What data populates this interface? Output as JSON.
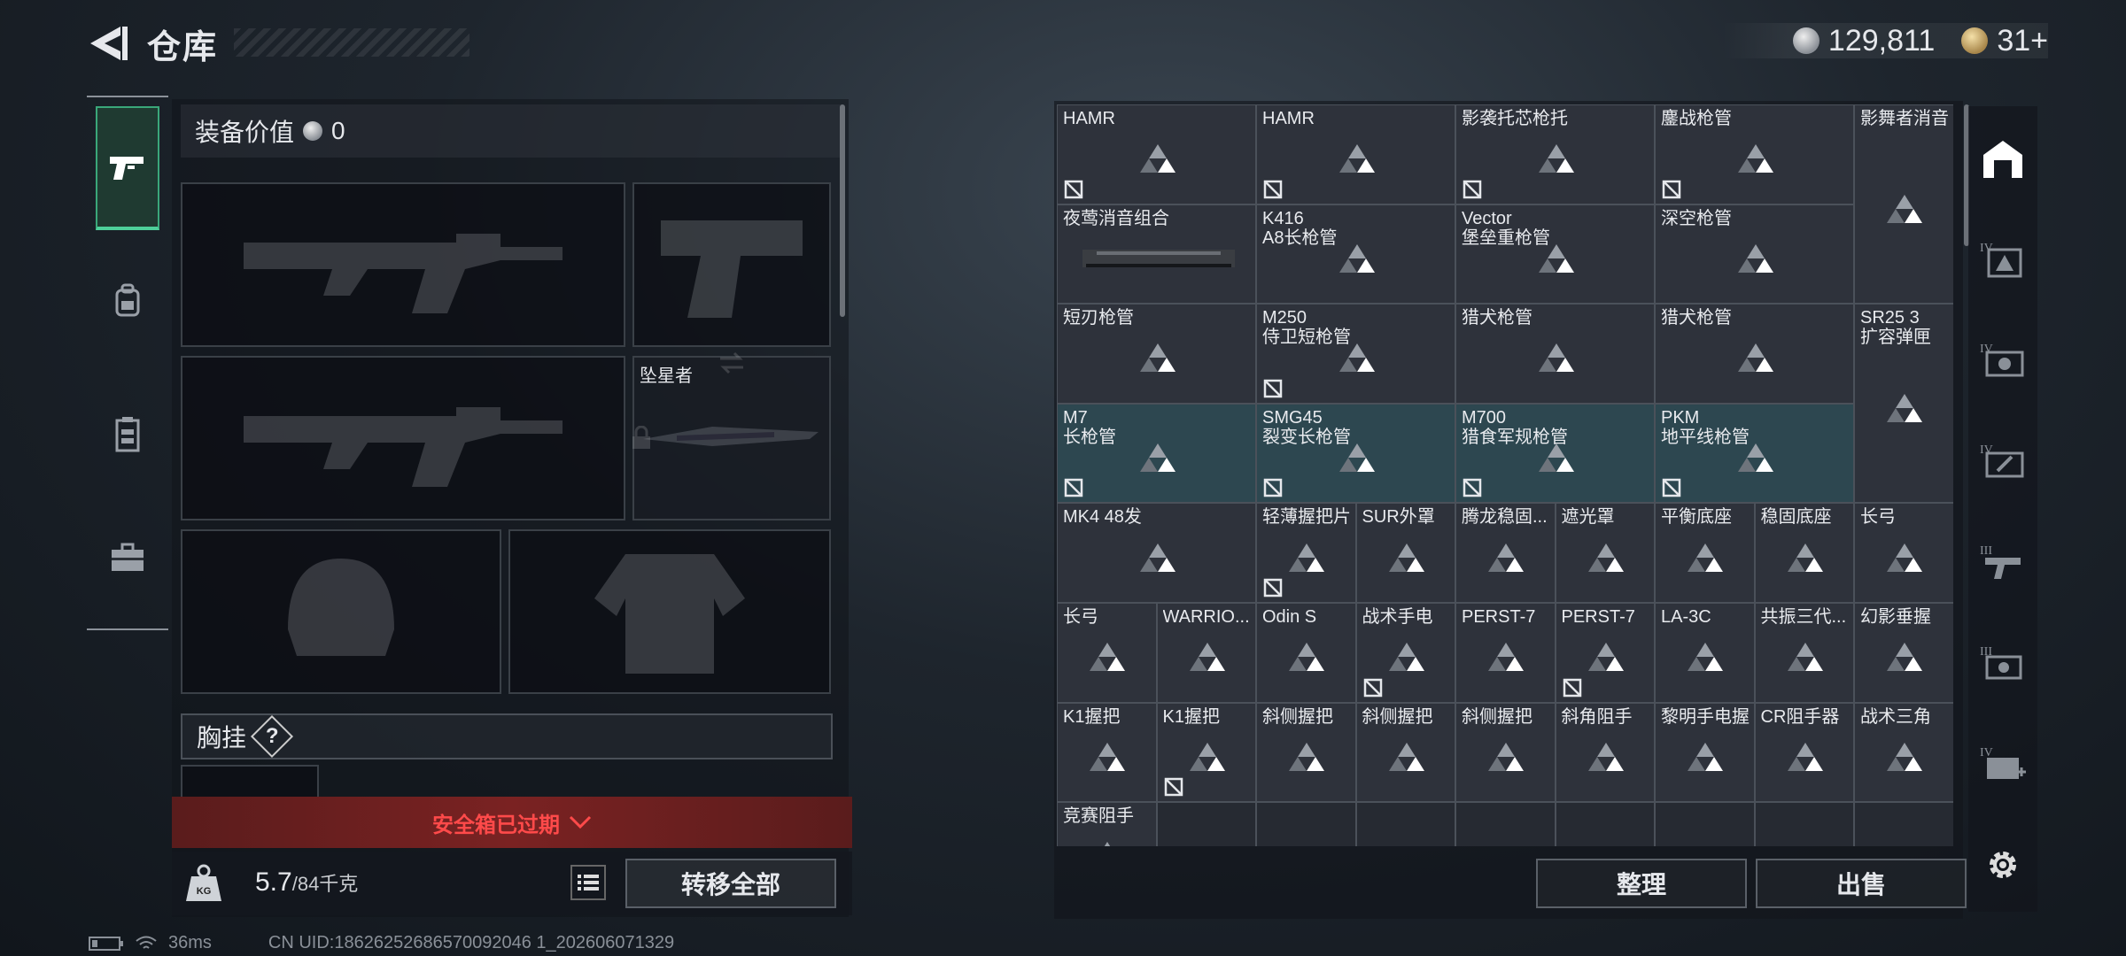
{
  "header": {
    "title": "仓库",
    "currency_silver": "129,811",
    "currency_gold": "31+"
  },
  "equipment": {
    "value_label": "装备价值",
    "value": "0",
    "melee_name": "坠星者",
    "chest_label": "胸挂",
    "chest_badge": "?",
    "safe_box_status": "安全箱已过期",
    "weight_current": "5.7",
    "weight_max": "/84千克",
    "transfer_all": "转移全部"
  },
  "grid": {
    "cells": [
      {
        "label": "HAMR",
        "no_enter": true,
        "type": "normal"
      },
      {
        "label": "HAMR",
        "no_enter": true,
        "type": "normal"
      },
      {
        "label": "影袭托芯枪托",
        "no_enter": true,
        "type": "normal"
      },
      {
        "label": "鏖战枪管",
        "no_enter": true,
        "type": "normal"
      },
      {
        "label": "影舞者消音",
        "no_enter": false,
        "type": "normal"
      },
      {
        "label": "夜莺消音组合",
        "no_enter": false,
        "type": "image"
      },
      {
        "label": "K416\nA8长枪管",
        "no_enter": false,
        "type": "normal"
      },
      {
        "label": "Vector\n堡垒重枪管",
        "no_enter": false,
        "type": "normal"
      },
      {
        "label": "深空枪管",
        "no_enter": false,
        "type": "normal"
      },
      {
        "label": "短刃枪管",
        "no_enter": false,
        "type": "normal"
      },
      {
        "label": "M250\n侍卫短枪管",
        "no_enter": true,
        "type": "normal"
      },
      {
        "label": "猎犬枪管",
        "no_enter": false,
        "type": "normal"
      },
      {
        "label": "猎犬枪管",
        "no_enter": false,
        "type": "normal"
      },
      {
        "label": "SR25 3\n扩容弹匣",
        "no_enter": false,
        "type": "normal"
      },
      {
        "label": "M7\n长枪管",
        "no_enter": true,
        "type": "hl"
      },
      {
        "label": "SMG45\n裂变长枪管",
        "no_enter": true,
        "type": "hl"
      },
      {
        "label": "M700\n猎食军规枪管",
        "no_enter": true,
        "type": "hl"
      },
      {
        "label": "PKM\n地平线枪管",
        "no_enter": true,
        "type": "hl"
      },
      {
        "label": "MK4 48发",
        "no_enter": false,
        "type": "normal"
      },
      {
        "label": "轻薄握把片",
        "no_enter": true,
        "type": "normal"
      },
      {
        "label": "SUR外罩",
        "no_enter": false,
        "type": "normal"
      },
      {
        "label": "腾龙稳固...",
        "no_enter": false,
        "type": "normal"
      },
      {
        "label": "遮光罩",
        "no_enter": false,
        "type": "normal"
      },
      {
        "label": "平衡底座",
        "no_enter": false,
        "type": "normal"
      },
      {
        "label": "稳固底座",
        "no_enter": false,
        "type": "normal"
      },
      {
        "label": "长弓",
        "no_enter": false,
        "type": "normal"
      },
      {
        "label": "长弓",
        "no_enter": false,
        "type": "normal"
      },
      {
        "label": "WARRIO...",
        "no_enter": false,
        "type": "normal"
      },
      {
        "label": "Odin S",
        "no_enter": false,
        "type": "normal"
      },
      {
        "label": "战术手电",
        "no_enter": true,
        "type": "normal"
      },
      {
        "label": "PERST-7",
        "no_enter": false,
        "type": "normal"
      },
      {
        "label": "PERST-7",
        "no_enter": true,
        "type": "normal"
      },
      {
        "label": "LA-3C",
        "no_enter": false,
        "type": "normal"
      },
      {
        "label": "共振三代...",
        "no_enter": false,
        "type": "normal"
      },
      {
        "label": "幻影垂握",
        "no_enter": false,
        "type": "normal"
      },
      {
        "label": "K1握把",
        "no_enter": false,
        "type": "normal"
      },
      {
        "label": "K1握把",
        "no_enter": true,
        "type": "normal"
      },
      {
        "label": "斜侧握把",
        "no_enter": false,
        "type": "normal"
      },
      {
        "label": "斜侧握把",
        "no_enter": false,
        "type": "normal"
      },
      {
        "label": "斜侧握把",
        "no_enter": false,
        "type": "normal"
      },
      {
        "label": "斜角阻手",
        "no_enter": false,
        "type": "normal"
      },
      {
        "label": "黎明手电握",
        "no_enter": false,
        "type": "normal"
      },
      {
        "label": "CR阻手器",
        "no_enter": false,
        "type": "normal"
      },
      {
        "label": "战术三角",
        "no_enter": false,
        "type": "normal"
      },
      {
        "label": "竞赛阻手",
        "no_enter": false,
        "type": "normal"
      }
    ],
    "sort_label": "整理",
    "sell_label": "出售"
  },
  "status": {
    "ping": "36ms",
    "uid": "CN UID:18626252686570092046 1_202606071329"
  },
  "icons": {
    "left_tabs": [
      "pistol-icon",
      "backpack-icon",
      "vest-icon",
      "toolbox-icon"
    ],
    "right_tabs": [
      "safe-house-icon",
      "tier4-storage-icon",
      "tier4-case-icon",
      "tier4-tool-icon",
      "tier3-gun-icon",
      "tier3-case-icon",
      "tier4-medical-icon"
    ]
  }
}
